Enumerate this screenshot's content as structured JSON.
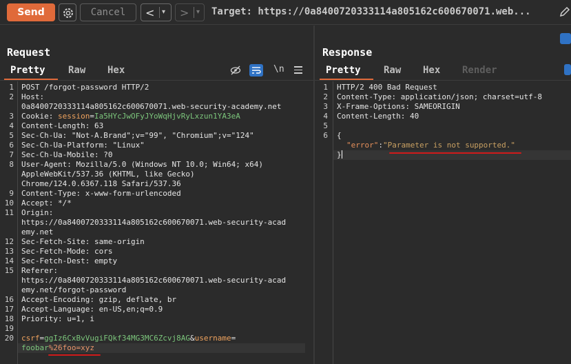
{
  "toolbar": {
    "send_label": "Send",
    "cancel_label": "Cancel",
    "back_glyph": "<",
    "forward_glyph": ">",
    "dropdown_glyph": "▾",
    "target_text": "Target: https://0a8400720333114a805162c600670071.web..."
  },
  "request": {
    "title": "Request",
    "tabs": [
      {
        "label": "Pretty",
        "active": true
      },
      {
        "label": "Raw",
        "active": false
      },
      {
        "label": "Hex",
        "active": false
      }
    ],
    "newline_label": "\\n",
    "line_numbers": [
      "1",
      "2",
      "3",
      "4",
      "5",
      "6",
      "7",
      "8",
      "9",
      "10",
      "11",
      "12",
      "13",
      "14",
      "15",
      "16",
      "17",
      "18",
      "19",
      "20"
    ],
    "lines": {
      "l1": "POST /forgot-password HTTP/2",
      "l2a": "Host: ",
      "l2b": "0a8400720333114a805162c600670071.web-security-academy.net",
      "l3_key": "Cookie: ",
      "l3_name": "session",
      "l3_eq": "=",
      "l3_val": "Ia5HYcJwOFyJYoWqHjvRyLxzun1YA3eA",
      "l4": "Content-Length: 63",
      "l5": "Sec-Ch-Ua: \"Not-A.Brand\";v=\"99\", \"Chromium\";v=\"124\"",
      "l6": "Sec-Ch-Ua-Platform: \"Linux\"",
      "l7": "Sec-Ch-Ua-Mobile: ?0",
      "l8a": "User-Agent: Mozilla/5.0 (Windows NT 10.0; Win64; x64)",
      "l8b": "AppleWebKit/537.36 (KHTML, like Gecko)",
      "l8c": "Chrome/124.0.6367.118 Safari/537.36",
      "l9": "Content-Type: x-www-form-urlencoded",
      "l10": "Accept: */*",
      "l11a": "Origin:",
      "l11b": "https://0a8400720333114a805162c600670071.web-security-acad",
      "l11c": "emy.net",
      "l12": "Sec-Fetch-Site: same-origin",
      "l13": "Sec-Fetch-Mode: cors",
      "l14": "Sec-Fetch-Dest: empty",
      "l15a": "Referer:",
      "l15b": "https://0a8400720333114a805162c600670071.web-security-acad",
      "l15c": "emy.net/forgot-password",
      "l16": "Accept-Encoding: gzip, deflate, br",
      "l17": "Accept-Language: en-US,en;q=0.9",
      "l18": "Priority: u=1, i",
      "l20_k1": "csrf",
      "l20_eq1": "=",
      "l20_v1": "ggIz6CxBvVugiFQkf34MG3MC6Zcvj8AG",
      "l20_amp": "&",
      "l20_k2": "username",
      "l20_eq2": "=",
      "l20b_v2": "foobar",
      "l20b_enc": "%26foo=xyz"
    }
  },
  "response": {
    "title": "Response",
    "tabs": [
      {
        "label": "Pretty",
        "active": true
      },
      {
        "label": "Raw",
        "active": false
      },
      {
        "label": "Hex",
        "active": false
      },
      {
        "label": "Render",
        "active": false
      }
    ],
    "line_numbers": [
      "1",
      "2",
      "3",
      "4",
      "5",
      "6"
    ],
    "lines": {
      "l1": "HTTP/2 400 Bad Request",
      "l2": "Content-Type: application/json; charset=utf-8",
      "l3": "X-Frame-Options: SAMEORIGIN",
      "l4": "Content-Length: 40",
      "l6_open": "{",
      "json_key": "\"error\"",
      "json_colon": ":",
      "json_val": "\"Parameter is not supported.\"",
      "json_close": "}"
    }
  },
  "colors": {
    "accent": "#e06a3a",
    "annotation": "#d11a1a",
    "active_icon": "#2f72c4"
  }
}
